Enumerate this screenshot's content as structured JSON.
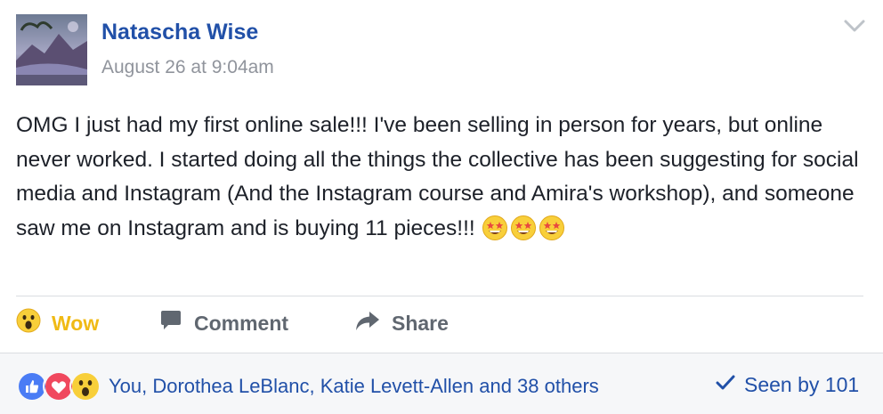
{
  "post": {
    "author": "Natascha Wise",
    "timestamp": "August 26 at 9:04am",
    "text": "OMG I just had my first online sale!!! I've been selling in person for years, but online never worked. I started doing all the things the collective has been suggesting for social media and Instagram (And the Instagram course and Amira's workshop), and someone saw me on Instagram and is buying 11 pieces!!! ",
    "emojis": [
      "star-struck-icon",
      "star-struck-icon",
      "star-struck-icon"
    ]
  },
  "actions": {
    "wow_label": "Wow",
    "comment_label": "Comment",
    "share_label": "Share"
  },
  "footer": {
    "reaction_icons": [
      "like-icon",
      "love-icon",
      "wow-icon"
    ],
    "reactors": "You, Dorothea LeBlanc, Katie Levett-Allen and 38 others",
    "seen": "Seen by 101"
  },
  "colors": {
    "link": "#2150a8",
    "wow": "#f0ba15",
    "muted": "#90949c"
  }
}
